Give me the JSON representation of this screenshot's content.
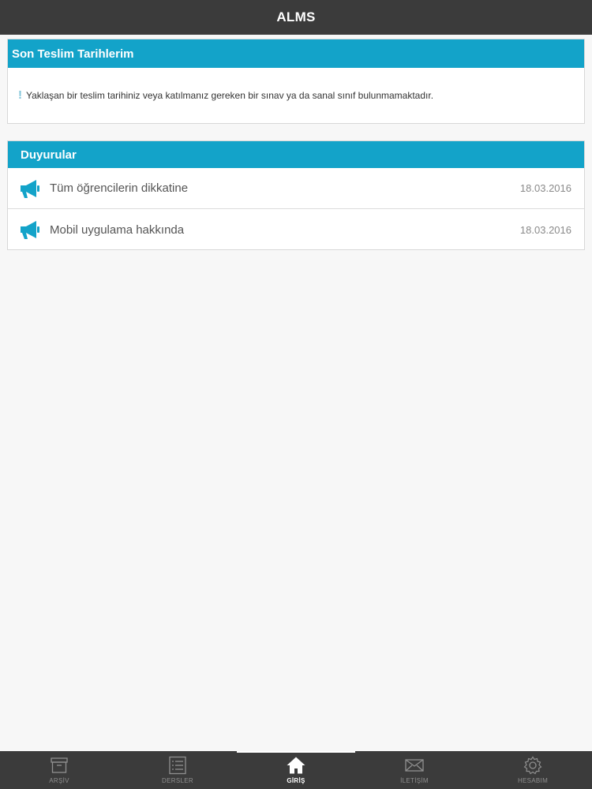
{
  "app": {
    "title": "ALMS"
  },
  "deadlines": {
    "header": "Son Teslim Tarihlerim",
    "message": "Yaklaşan bir teslim tarihiniz veya katılmanız gereken bir sınav ya da sanal sınıf bulunmamaktadır.",
    "icon": "exclamation-icon"
  },
  "announcements": {
    "header": "Duyurular",
    "icon": "megaphone-icon",
    "icon_color": "#13a3c9",
    "items": [
      {
        "title": "Tüm öğrencilerin dikkatine",
        "date": "18.03.2016"
      },
      {
        "title": "Mobil uygulama hakkında",
        "date": "18.03.2016"
      }
    ]
  },
  "tabs": [
    {
      "label": "ARŞİV",
      "icon": "archive-icon",
      "active": false
    },
    {
      "label": "DERSLER",
      "icon": "list-icon",
      "active": false
    },
    {
      "label": "GİRİŞ",
      "icon": "home-icon",
      "active": true
    },
    {
      "label": "İLETİŞİM",
      "icon": "mail-icon",
      "active": false
    },
    {
      "label": "HESABIM",
      "icon": "gear-icon",
      "active": false
    }
  ],
  "colors": {
    "accent": "#13a3c9",
    "bar": "#3b3b3b",
    "background": "#f7f7f7"
  }
}
